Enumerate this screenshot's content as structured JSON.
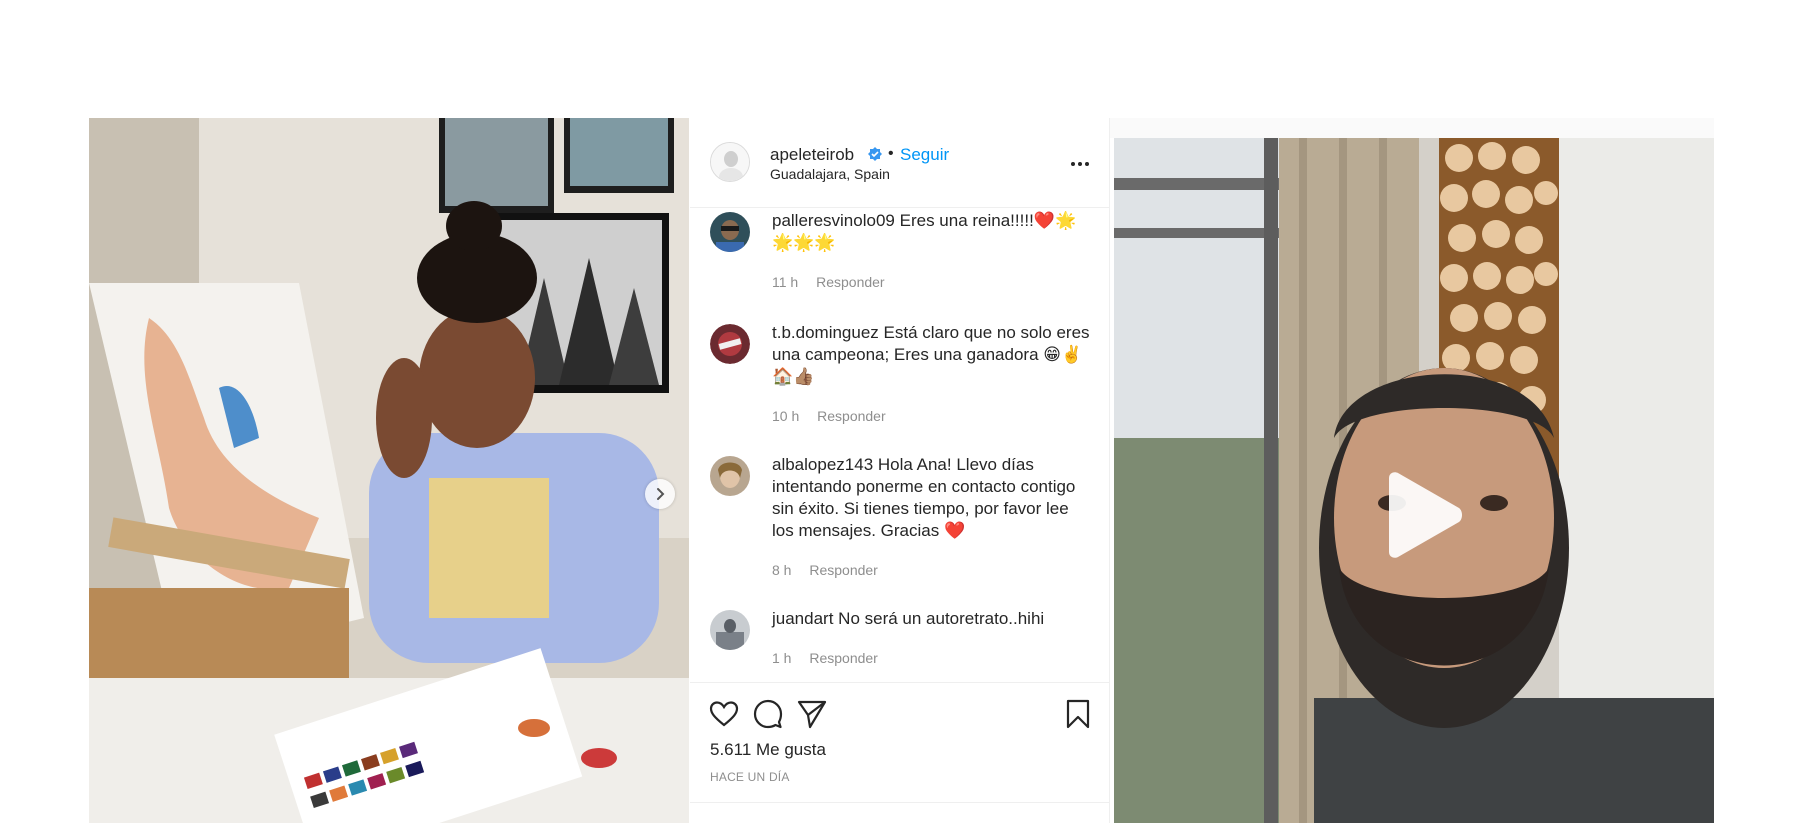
{
  "post": {
    "username": "apeleteirob",
    "follow_label": "Seguir",
    "separator": "•",
    "location": "Guadalajara, Spain",
    "likes": "5.611 Me gusta",
    "date": "HACE UN DÍA"
  },
  "comments": [
    {
      "user": "palleresvinolo09",
      "text": "Eres una reina!!!!!❤️🌟🌟🌟🌟",
      "time": "11 h",
      "reply": "Responder"
    },
    {
      "user": "t.b.dominguez",
      "text": "Está claro que no solo eres una campeona; Eres una ganadora 😁✌️🏠👍🏽",
      "time": "10 h",
      "reply": "Responder"
    },
    {
      "user": "albalopez143",
      "text": "Hola Ana! Llevo días intentando ponerme en contacto contigo sin éxito. Si tienes tiempo, por favor lee los mensajes. Gracias ❤️",
      "time": "8 h",
      "reply": "Responder"
    },
    {
      "user": "juandart",
      "text": "No será un autoretrato..hihi",
      "time": "1 h",
      "reply": "Responder"
    }
  ],
  "icons": {
    "verified": "verified-badge-icon",
    "more": "more-options-icon",
    "like": "heart-icon",
    "comment": "comment-icon",
    "share": "send-icon",
    "save": "bookmark-icon",
    "next": "chevron-right-icon",
    "play": "play-icon"
  },
  "colors": {
    "link_blue": "#0095f6",
    "verified_blue": "#3897f0",
    "secondary_text": "#8e8e8e",
    "primary_text": "#262626"
  }
}
